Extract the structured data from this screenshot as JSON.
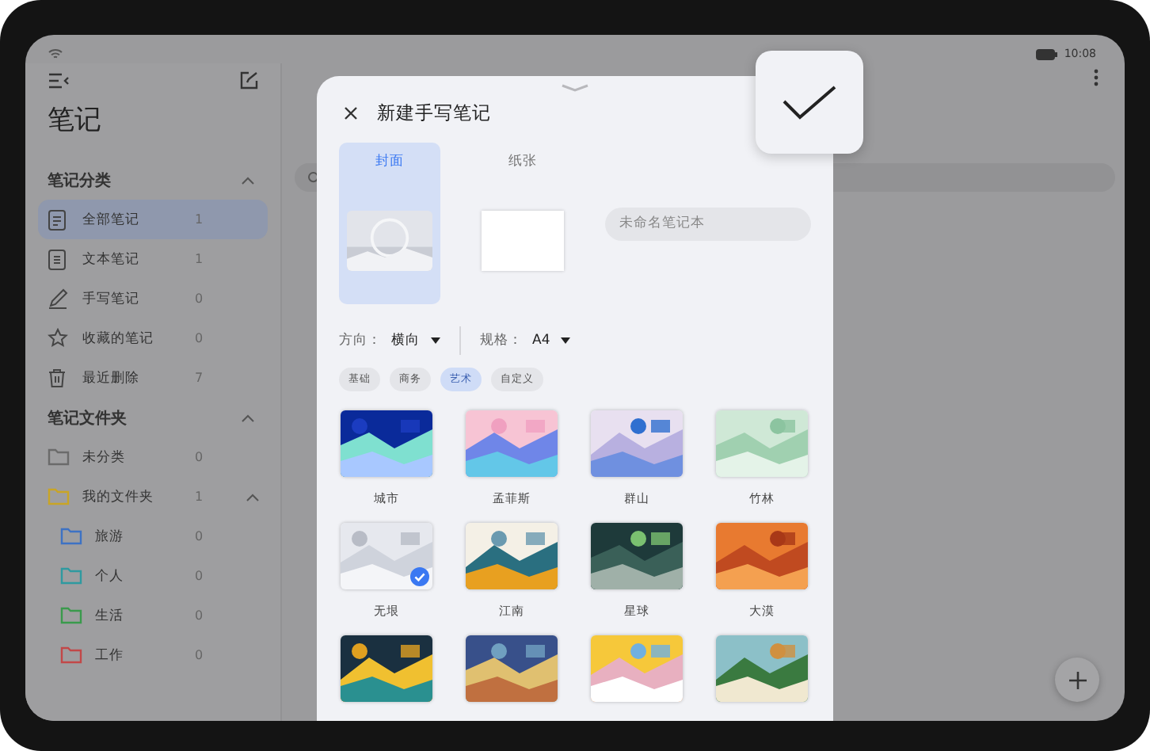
{
  "status_bar": {
    "time": "10:08"
  },
  "sidebar": {
    "title": "笔记",
    "sections": [
      {
        "title": "笔记分类",
        "expanded": true,
        "items": [
          {
            "label": "全部笔记",
            "count": "1",
            "kind": "doc",
            "selected": true
          },
          {
            "label": "文本笔记",
            "count": "1",
            "kind": "text",
            "selected": false
          },
          {
            "label": "手写笔记",
            "count": "0",
            "kind": "pen",
            "selected": false
          },
          {
            "label": "收藏的笔记",
            "count": "0",
            "kind": "star",
            "selected": false
          },
          {
            "label": "最近删除",
            "count": "7",
            "kind": "trash",
            "selected": false
          }
        ]
      },
      {
        "title": "笔记文件夹",
        "expanded": true,
        "items": [
          {
            "label": "未分类",
            "count": "0",
            "kind": "folder",
            "color": "#6b6b6b",
            "selected": false
          },
          {
            "label": "我的文件夹",
            "count": "1",
            "kind": "folder",
            "color": "#c9a526",
            "selected": false,
            "expanded": true,
            "children": [
              {
                "label": "旅游",
                "count": "0",
                "color": "#3d72c4",
                "selected": false
              },
              {
                "label": "个人",
                "count": "0",
                "color": "#2f9aa0",
                "selected": false
              },
              {
                "label": "生活",
                "count": "0",
                "color": "#3a9a4c",
                "selected": false
              },
              {
                "label": "工作",
                "count": "0",
                "color": "#c24848",
                "selected": false
              }
            ]
          }
        ]
      }
    ]
  },
  "sheet": {
    "title": "新建手写笔记",
    "tabs": [
      {
        "label": "封面",
        "selected": true
      },
      {
        "label": "纸张",
        "selected": false
      }
    ],
    "name_field": {
      "placeholder": "未命名笔记本"
    },
    "options": [
      {
        "label": "方向：",
        "value": "横向"
      },
      {
        "label": "规格：",
        "value": "A4"
      }
    ],
    "categories": [
      {
        "label": "基础",
        "selected": false
      },
      {
        "label": "商务",
        "selected": false
      },
      {
        "label": "艺术",
        "selected": true
      },
      {
        "label": "自定义",
        "selected": false
      }
    ],
    "covers": [
      {
        "name": "城市",
        "selected": false
      },
      {
        "name": "孟菲斯",
        "selected": false
      },
      {
        "name": "群山",
        "selected": false
      },
      {
        "name": "竹林",
        "selected": false
      },
      {
        "name": "无垠",
        "selected": true
      },
      {
        "name": "江南",
        "selected": false
      },
      {
        "name": "星球",
        "selected": false
      },
      {
        "name": "大漠",
        "selected": false
      },
      {
        "selected": false
      },
      {
        "selected": false
      },
      {
        "selected": false
      },
      {
        "selected": false
      }
    ]
  }
}
